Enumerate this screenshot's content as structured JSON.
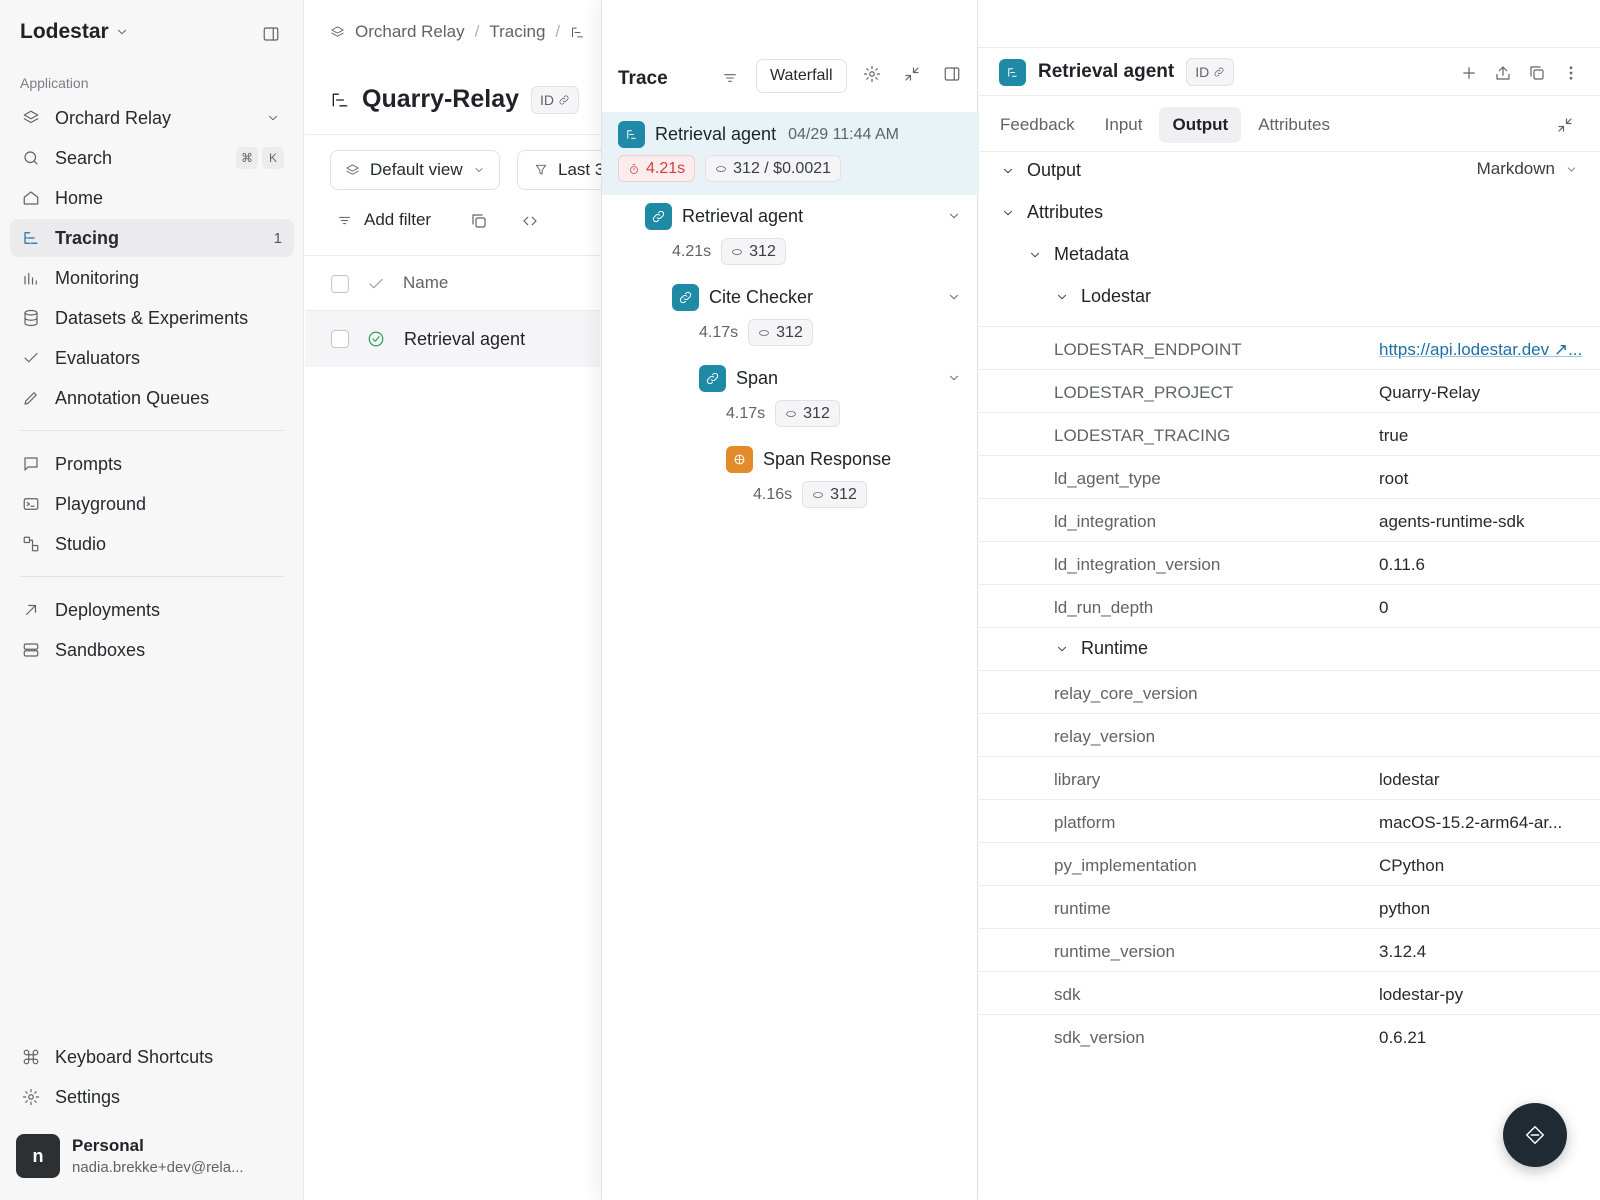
{
  "sidebar": {
    "brand": "Lodestar",
    "section_label": "Application",
    "project_selector": "Orchard Relay",
    "search": {
      "label": "Search",
      "kbd": [
        "⌘",
        "K"
      ]
    },
    "items": [
      {
        "label": "Home"
      },
      {
        "label": "Tracing",
        "count": "1"
      },
      {
        "label": "Monitoring"
      },
      {
        "label": "Datasets & Experiments"
      },
      {
        "label": "Evaluators"
      },
      {
        "label": "Annotation Queues"
      },
      {
        "label": "Prompts"
      },
      {
        "label": "Playground"
      },
      {
        "label": "Studio"
      },
      {
        "label": "Deployments"
      },
      {
        "label": "Sandboxes"
      }
    ],
    "footer": {
      "shortcuts": "Keyboard Shortcuts",
      "settings": "Settings",
      "avatar_letter": "n",
      "workspace": "Personal",
      "email": "nadia.brekke+dev@rela..."
    }
  },
  "main": {
    "breadcrumb": [
      "Orchard Relay",
      "Tracing"
    ],
    "title": "Quarry-Relay",
    "id_label": "ID",
    "view_label": "Default view",
    "range_label": "Last 3",
    "add_filter": "Add filter",
    "table": {
      "col_name": "Name",
      "rows": [
        {
          "name": "Retrieval agent"
        }
      ]
    }
  },
  "trace": {
    "title": "Trace",
    "view_mode": "Waterfall",
    "runs": [
      {
        "name": "Retrieval agent",
        "date": "04/29 11:44 AM",
        "latency": "4.21s",
        "tokens": "312 / $0.0021"
      },
      {
        "name": "Retrieval agent",
        "latency": "4.21s",
        "tokens": "312"
      },
      {
        "name": "Cite Checker",
        "latency": "4.17s",
        "tokens": "312"
      },
      {
        "name": "Span",
        "latency": "4.17s",
        "tokens": "312"
      },
      {
        "name": "Span Response",
        "latency": "4.16s",
        "tokens": "312"
      }
    ]
  },
  "details": {
    "title": "Retrieval agent",
    "id_label": "ID",
    "tabs": [
      "Feedback",
      "Input",
      "Output",
      "Attributes"
    ],
    "active_tab": "Output",
    "output_label": "Output",
    "format": "Markdown",
    "attributes_label": "Attributes",
    "metadata_label": "Metadata",
    "lodestar_label": "Lodestar",
    "runtime_label": "Runtime",
    "lodestar_rows": [
      {
        "key": "LODESTAR_ENDPOINT",
        "value": "https://api.lodestar.dev ↗..."
      },
      {
        "key": "LODESTAR_PROJECT",
        "value": "Quarry-Relay"
      },
      {
        "key": "LODESTAR_TRACING",
        "value": "true"
      },
      {
        "key": "ld_agent_type",
        "value": "root"
      },
      {
        "key": "ld_integration",
        "value": "agents-runtime-sdk"
      },
      {
        "key": "ld_integration_version",
        "value": "0.11.6"
      },
      {
        "key": "ld_run_depth",
        "value": "0"
      }
    ],
    "runtime_rows": [
      {
        "key": "relay_core_version",
        "value": ""
      },
      {
        "key": "relay_version",
        "value": ""
      },
      {
        "key": "library",
        "value": "lodestar"
      },
      {
        "key": "platform",
        "value": "macOS-15.2-arm64-ar..."
      },
      {
        "key": "py_implementation",
        "value": "CPython"
      },
      {
        "key": "runtime",
        "value": "python"
      },
      {
        "key": "runtime_version",
        "value": "3.12.4"
      },
      {
        "key": "sdk",
        "value": "lodestar-py"
      },
      {
        "key": "sdk_version",
        "value": "0.6.21"
      }
    ]
  }
}
